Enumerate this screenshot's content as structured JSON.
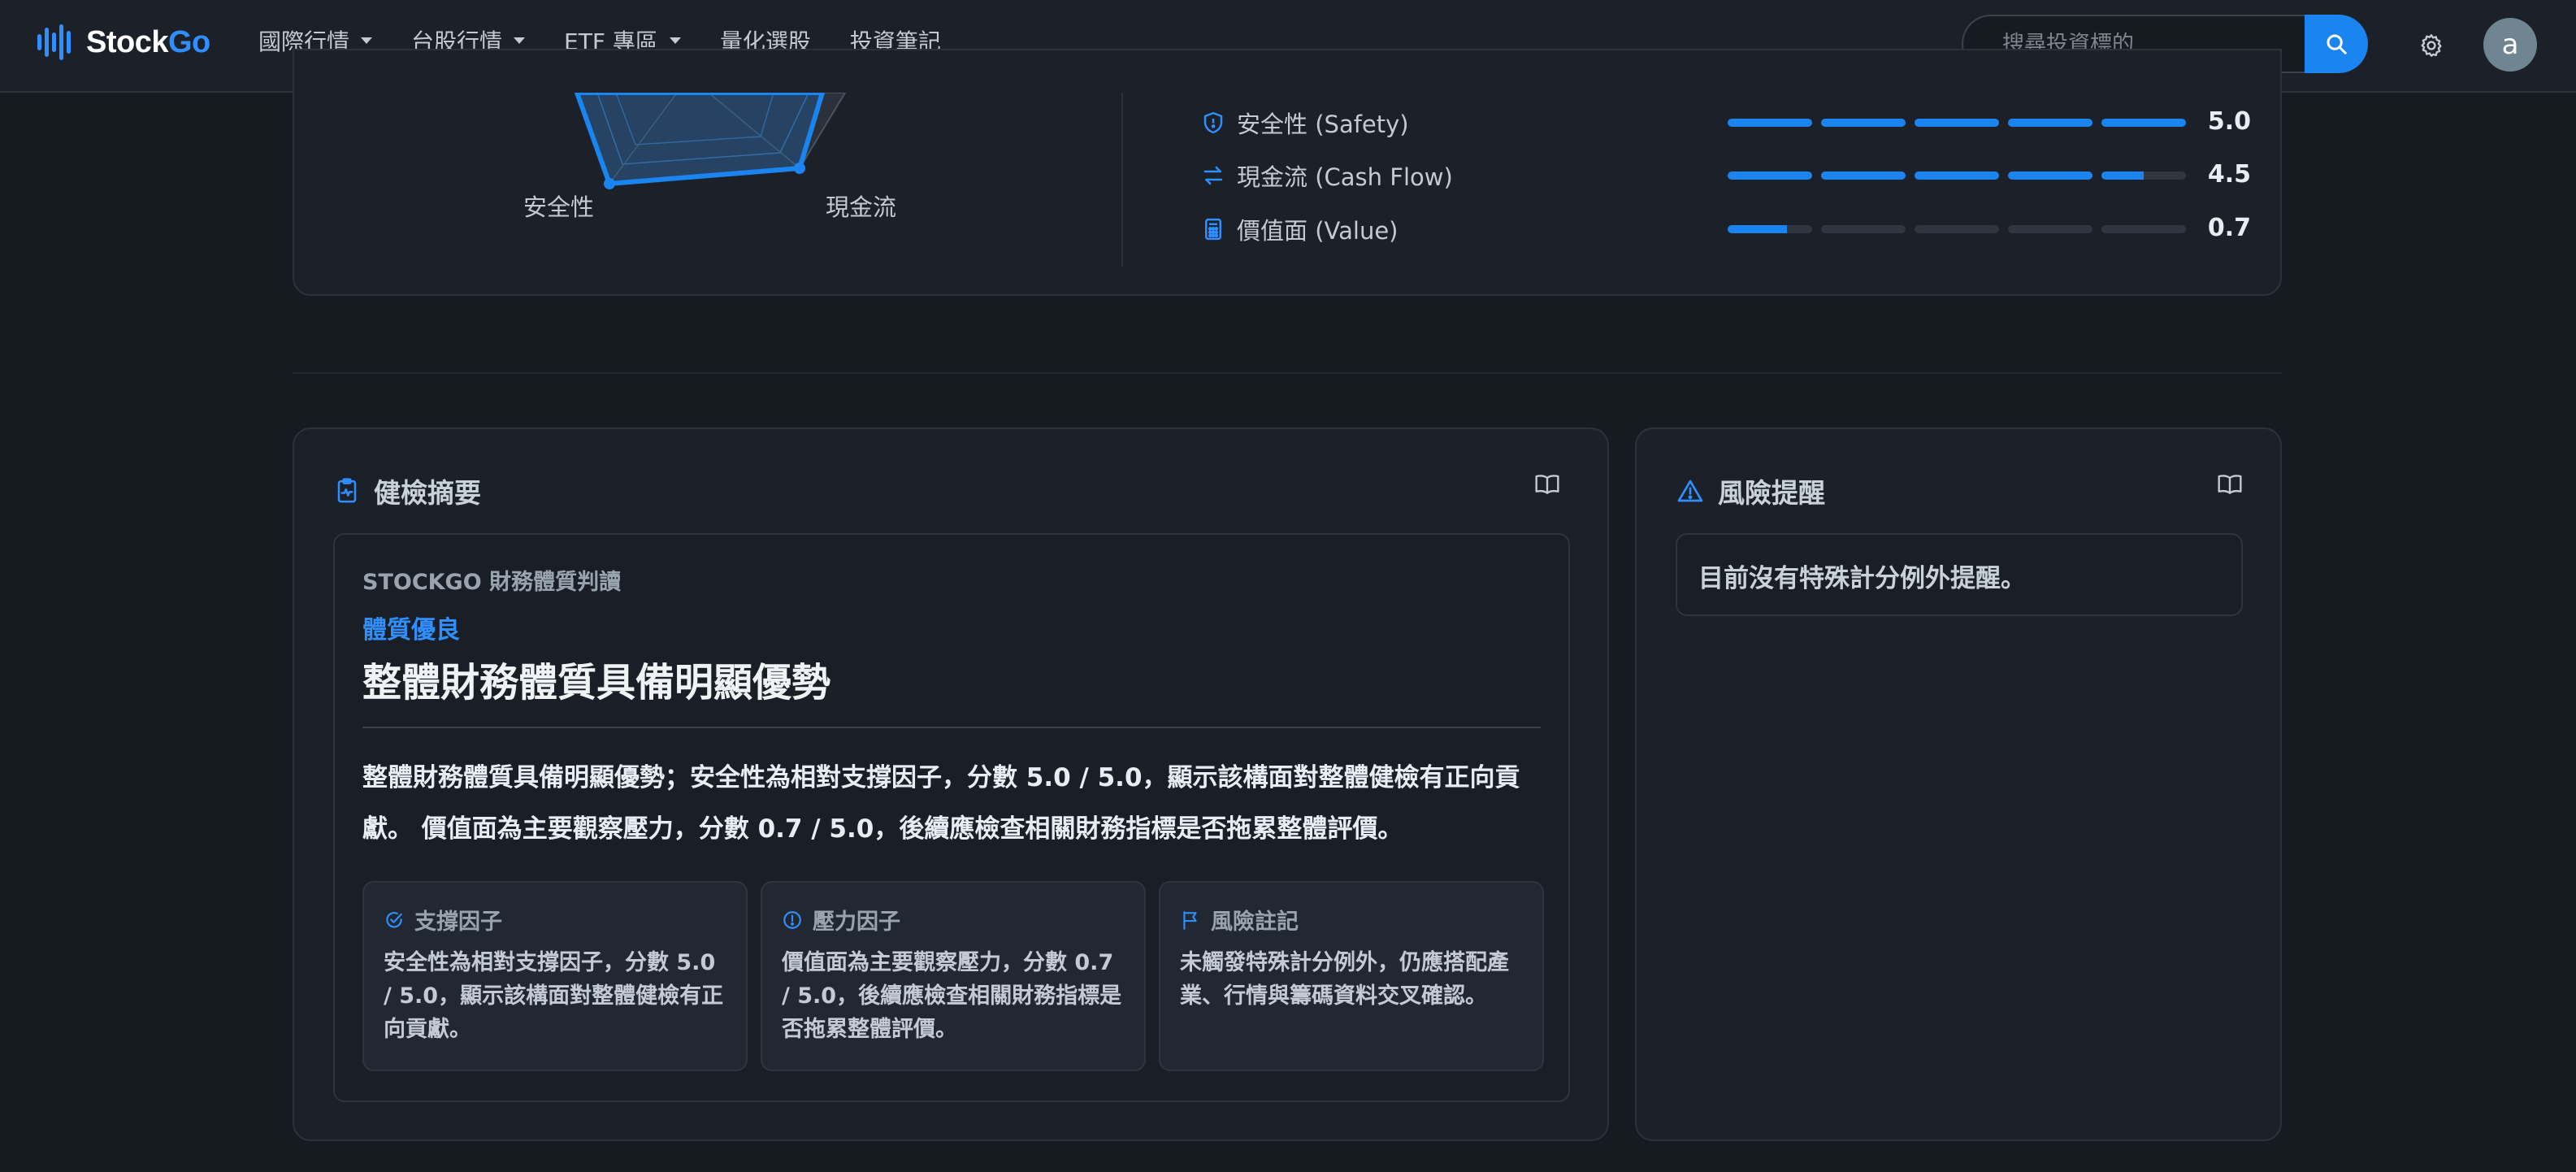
{
  "nav": {
    "logo_text": "Stock",
    "logo_accent": "Go",
    "items": [
      {
        "label": "國際行情",
        "dropdown": true
      },
      {
        "label": "台股行情",
        "dropdown": true
      },
      {
        "label": "ETF 專區",
        "dropdown": true
      },
      {
        "label": "量化選股",
        "dropdown": false
      },
      {
        "label": "投資筆記",
        "dropdown": false
      }
    ],
    "search_placeholder": "搜尋投資標的",
    "avatar_initial": "a"
  },
  "radar": {
    "labels": {
      "safety": "安全性",
      "cashflow": "現金流"
    }
  },
  "metrics": [
    {
      "label": "安全性 (Safety)",
      "score": "5.0",
      "value": 5.0,
      "max": 5,
      "icon": "shield-icon"
    },
    {
      "label": "現金流 (Cash Flow)",
      "score": "4.5",
      "value": 4.5,
      "max": 5,
      "icon": "exchange-icon"
    },
    {
      "label": "價值面 (Value)",
      "score": "0.7",
      "value": 0.7,
      "max": 5,
      "icon": "calculator-icon"
    }
  ],
  "summary": {
    "title": "健檢摘要",
    "eyebrow": "STOCKGO 財務體質判讀",
    "verdict": "體質優良",
    "headline": "整體財務體質具備明顯優勢",
    "body": "整體財務體質具備明顯優勢；安全性為相對支撐因子，分數 5.0 / 5.0，顯示該構面對整體健檢有正向貢獻。 價值面為主要觀察壓力，分數 0.7 / 5.0，後續應檢查相關財務指標是否拖累整體評價。",
    "factors": [
      {
        "title": "支撐因子",
        "text": "安全性為相對支撐因子，分數 5.0 / 5.0，顯示該構面對整體健檢有正向貢獻。",
        "icon": "check-badge-icon"
      },
      {
        "title": "壓力因子",
        "text": "價值面為主要觀察壓力，分數 0.7 / 5.0，後續應檢查相關財務指標是否拖累整體評價。",
        "icon": "alert-circle-icon"
      },
      {
        "title": "風險註記",
        "text": "未觸發特殊計分例外，仍應搭配產業、行情與籌碼資料交叉確認。",
        "icon": "flag-icon"
      }
    ]
  },
  "risk": {
    "title": "風險提醒",
    "text": "目前沒有特殊計分例外提醒。"
  },
  "colors": {
    "accent": "#1a84f0",
    "background": "#161b22",
    "card": "#1c2129"
  }
}
